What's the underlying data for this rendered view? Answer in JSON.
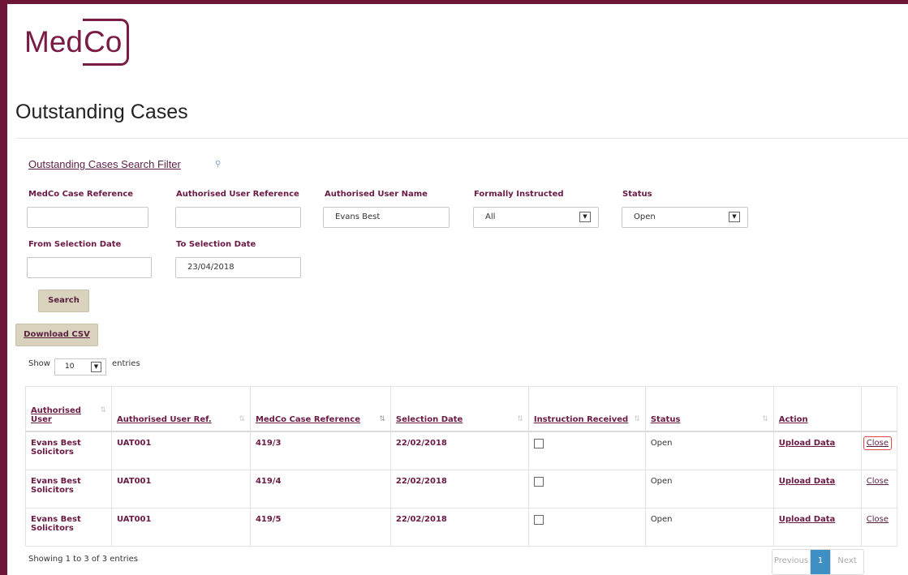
{
  "logo": {
    "med": "Med",
    "co": "Co"
  },
  "page_title": "Outstanding Cases",
  "filter": {
    "link": "Outstanding Cases Search Filter",
    "medco_ref_label": "MedCo Case Reference",
    "medco_ref_value": "",
    "auth_user_ref_label": "Authorised User Reference",
    "auth_user_ref_value": "",
    "auth_user_name_label": "Authorised User Name",
    "auth_user_name_value": "Evans Best",
    "formally_label": "Formally Instructed",
    "formally_value": "All",
    "status_label": "Status",
    "status_value": "Open",
    "from_date_label": "From Selection Date",
    "from_date_value": "",
    "to_date_label": "To Selection Date",
    "to_date_value": "23/04/2018",
    "search_button": "Search"
  },
  "download_csv": "Download CSV",
  "table_controls": {
    "show": "Show",
    "page_size": "10",
    "entries": "entries"
  },
  "columns": [
    "Authorised User",
    "Authorised User Ref.",
    "MedCo Case Reference",
    "Selection Date",
    "Instruction Received",
    "Status",
    "Action",
    ""
  ],
  "rows": [
    {
      "user": "Evans Best Solicitors",
      "user_ref": "UAT001",
      "case_ref": "419/3",
      "date": "22/02/2018",
      "status": "Open",
      "action": "Upload Data",
      "close": "Close"
    },
    {
      "user": "Evans Best Solicitors",
      "user_ref": "UAT001",
      "case_ref": "419/4",
      "date": "22/02/2018",
      "status": "Open",
      "action": "Upload Data",
      "close": "Close"
    },
    {
      "user": "Evans Best Solicitors",
      "user_ref": "UAT001",
      "case_ref": "419/5",
      "date": "22/02/2018",
      "status": "Open",
      "action": "Upload Data",
      "close": "Close"
    }
  ],
  "footer": {
    "info": "Showing 1 to 3 of 3 entries",
    "previous": "Previous",
    "page": "1",
    "next": "Next"
  },
  "colors": {
    "brand": "#7a1b45",
    "button": "#d9d3bd",
    "pager_active": "#3d8fc4",
    "highlight": "#e04a4a"
  }
}
